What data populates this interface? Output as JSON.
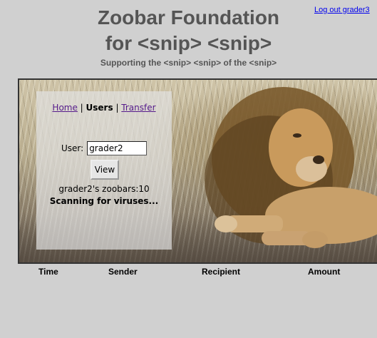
{
  "header": {
    "logout_label": "Log out grader3",
    "title_line1": "Zoobar Foundation",
    "title_line2": "for <snip> <snip>",
    "subtitle": "Supporting the <snip> <snip> of the <snip>"
  },
  "nav": {
    "home": "Home",
    "separator1": " | ",
    "users": "Users",
    "separator2": " | ",
    "transfer": "Transfer"
  },
  "user_form": {
    "label": "User:",
    "input_value": "grader2",
    "view_button": "View"
  },
  "profile": {
    "zoobars_text": "grader2's zoobars:10",
    "status_text": "Scanning for viruses..."
  },
  "table": {
    "headers": [
      "Time",
      "Sender",
      "Recipient",
      "Amount"
    ]
  },
  "colors": {
    "background": "#d0d0d0",
    "title": "#555555",
    "link": "#0000ee",
    "visited_link": "#551a8b"
  }
}
